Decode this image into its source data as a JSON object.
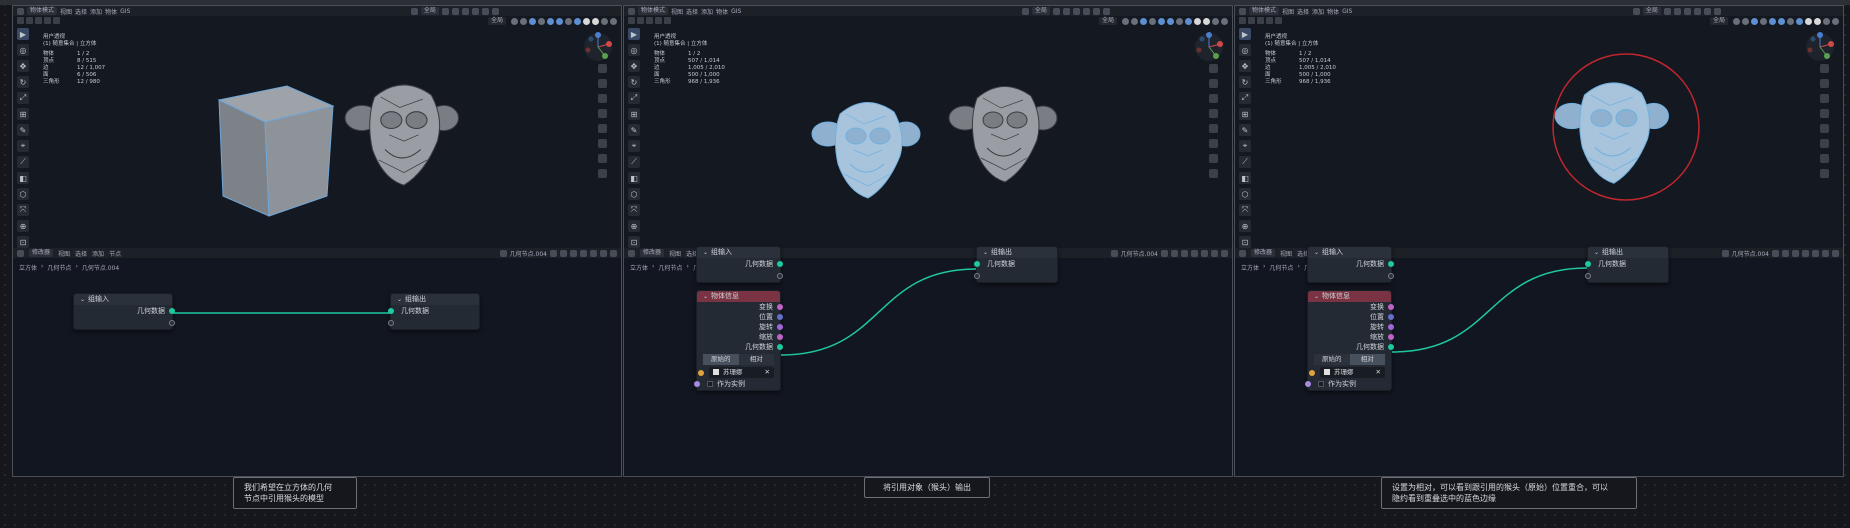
{
  "panels": [
    {
      "viewport": {
        "mode": "物体模式",
        "menus": [
          "视图",
          "选择",
          "添加",
          "物体",
          "GIS"
        ],
        "orientation": "全局",
        "view_name": "用户透视",
        "collection": "(1) 随意集合 | 立方体",
        "stats": [
          [
            "物体",
            "1 / 2"
          ],
          [
            "顶点",
            "8 / 515"
          ],
          [
            "边",
            "12 / 1,007"
          ],
          [
            "面",
            "6 / 506"
          ],
          [
            "三角形",
            "12 / 980"
          ]
        ]
      },
      "node_editor": {
        "type": "修改器",
        "menus": [
          "视图",
          "选择",
          "添加",
          "节点"
        ],
        "tree_name": "几何节点.004",
        "breadcrumb": [
          "立方体",
          "几何节点",
          "几何节点.004"
        ],
        "group_input": {
          "title": "组输入",
          "socket": "几何数据"
        },
        "group_output": {
          "title": "组输出",
          "socket": "几何数据"
        }
      },
      "caption": [
        "我们希望在立方体的几何",
        "节点中引用猴头的模型"
      ]
    },
    {
      "viewport": {
        "mode": "物体模式",
        "menus": [
          "视图",
          "选择",
          "添加",
          "物体",
          "GIS"
        ],
        "orientation": "全局",
        "view_name": "用户透视",
        "collection": "(1) 随意集合 | 立方体",
        "stats": [
          [
            "物体",
            "1 / 2"
          ],
          [
            "顶点",
            "507 / 1,014"
          ],
          [
            "边",
            "1,005 / 2,010"
          ],
          [
            "面",
            "500 / 1,000"
          ],
          [
            "三角形",
            "968 / 1,936"
          ]
        ]
      },
      "node_editor": {
        "type": "修改器",
        "menus": [
          "视图",
          "选择",
          "添加",
          "节点"
        ],
        "tree_name": "几何节点.004",
        "breadcrumb": [
          "立方体",
          "几何节点",
          "几何节点.004"
        ],
        "group_input": {
          "title": "组输入",
          "socket": "几何数据"
        },
        "group_output": {
          "title": "组输出",
          "socket": "几何数据"
        },
        "object_info": {
          "title": "物体信息",
          "outputs": [
            "变换",
            "位置",
            "旋转",
            "缩放",
            "几何数据"
          ],
          "modes": [
            "原始的",
            "相对"
          ],
          "active_mode": 0,
          "object": "苏珊娜",
          "as_instance": "作为实例"
        }
      },
      "caption": [
        "将引用对象（猴头）输出"
      ]
    },
    {
      "viewport": {
        "mode": "物体模式",
        "menus": [
          "视图",
          "选择",
          "添加",
          "物体",
          "GIS"
        ],
        "orientation": "全局",
        "view_name": "用户透视",
        "collection": "(1) 随意集合 | 立方体",
        "stats": [
          [
            "物体",
            "1 / 2"
          ],
          [
            "顶点",
            "507 / 1,014"
          ],
          [
            "边",
            "1,005 / 2,010"
          ],
          [
            "面",
            "500 / 1,000"
          ],
          [
            "三角形",
            "968 / 1,936"
          ]
        ]
      },
      "node_editor": {
        "type": "修改器",
        "menus": [
          "视图",
          "选择",
          "添加",
          "节点"
        ],
        "tree_name": "几何节点.004",
        "breadcrumb": [
          "立方体",
          "几何节点",
          "几何节点.004"
        ],
        "group_input": {
          "title": "组输入",
          "socket": "几何数据"
        },
        "group_output": {
          "title": "组输出",
          "socket": "几何数据"
        },
        "object_info": {
          "title": "物体信息",
          "outputs": [
            "变换",
            "位置",
            "旋转",
            "缩放",
            "几何数据"
          ],
          "modes": [
            "原始的",
            "相对"
          ],
          "active_mode": 1,
          "object": "苏珊娜",
          "as_instance": "作为实例"
        }
      },
      "caption": [
        "设置为相对，可以看到跟引用的猴头（原始）位置重合，可以",
        "隐约看到重叠选中的蓝色边缘"
      ]
    }
  ],
  "colors": {
    "accent": "#1ec8a0",
    "object_info_header": "#7a3342",
    "highlight_circle": "#c0262d"
  }
}
